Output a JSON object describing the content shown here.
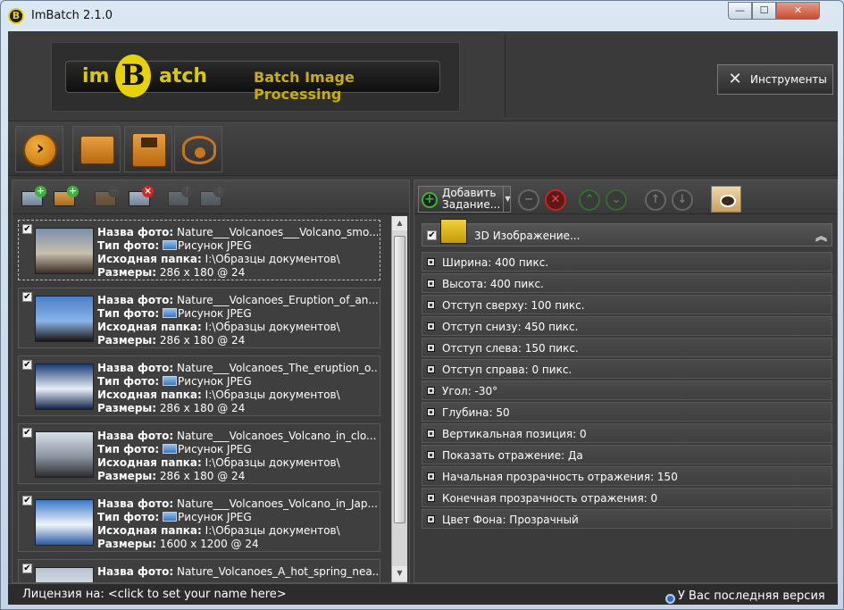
{
  "window": {
    "title": "ImBatch 2.1.0",
    "app_icon": "B",
    "min": "—",
    "max": "☐",
    "close": "✕"
  },
  "header": {
    "brand_im": "im",
    "brand_b": "B",
    "brand_atch": "atch",
    "tagline": "Batch Image Processing",
    "tools_label": "Инструменты",
    "tools_icon": "wrench-icon"
  },
  "main_toolbar": [
    {
      "name": "run-batch-button",
      "icon": "arrow-right-icon",
      "glyph": "›"
    },
    {
      "name": "open-folder-button",
      "icon": "folder-icon"
    },
    {
      "name": "save-button",
      "icon": "floppy-disk-icon"
    },
    {
      "name": "preview-button",
      "icon": "eye-icon"
    }
  ],
  "files": [
    {
      "name_label": "Назва фото:",
      "name": "Nature___Volcanoes___Volcano_smo...",
      "type_label": "Тип фото:",
      "type": "Рисунок JPEG",
      "folder_label": "Исходная папка:",
      "folder": "I:\\Образцы документов\\",
      "size_label": "Размеры:",
      "size": "286 x 180 @ 24",
      "checked": true,
      "thumb_colors": [
        "#7a8fa8",
        "#c8c0b0",
        "#3a2c22"
      ]
    },
    {
      "name_label": "Назва фото:",
      "name": "Nature___Volcanoes_Eruption_of_an...",
      "type_label": "Тип фото:",
      "type": "Рисунок JPEG",
      "folder_label": "Исходная папка:",
      "folder": "I:\\Образцы документов\\",
      "size_label": "Размеры:",
      "size": "286 x 180 @ 24",
      "checked": true,
      "thumb_colors": [
        "#4a7ec8",
        "#8ab4e8",
        "#1a1410"
      ]
    },
    {
      "name_label": "Назва фото:",
      "name": "Nature___Volcanoes_The_eruption_o...",
      "type_label": "Тип фото:",
      "type": "Рисунок JPEG",
      "folder_label": "Исходная папка:",
      "folder": "I:\\Образцы документов\\",
      "size_label": "Размеры:",
      "size": "286 x 180 @ 24",
      "checked": true,
      "thumb_colors": [
        "#1c3c78",
        "#e8eef6",
        "#142448"
      ]
    },
    {
      "name_label": "Назва фото:",
      "name": "Nature___Volcanoes_Volcano_in_clo...",
      "type_label": "Тип фото:",
      "type": "Рисунок JPEG",
      "folder_label": "Исходная папка:",
      "folder": "I:\\Образцы документов\\",
      "size_label": "Размеры:",
      "size": "286 x 180 @ 24",
      "checked": true,
      "thumb_colors": [
        "#d8e0e8",
        "#8a94a0",
        "#2c2c30"
      ]
    },
    {
      "name_label": "Назва фото:",
      "name": "Nature___Volcanoes_Volcano_in_Jap...",
      "type_label": "Тип фото:",
      "type": "Рисунок JPEG",
      "folder_label": "Исходная папка:",
      "folder": "I:\\Образцы документов\\",
      "size_label": "Размеры:",
      "size": "1600 x 1200 @ 24",
      "checked": true,
      "thumb_colors": [
        "#3a78c8",
        "#f0f4fa",
        "#2a5aa0"
      ]
    },
    {
      "name_label": "Назва фото:",
      "name": "Nature_Volcanoes_A_hot_spring_nea...",
      "checked": true,
      "thumb_colors": [
        "#b8c4d0",
        "#e0e4ea",
        "#8090a0"
      ]
    }
  ],
  "task": {
    "add_label": "Добавить Задание...",
    "title": "3D Изображение...",
    "collapse": "︽",
    "checked": true,
    "props": [
      "Ширина: 400 пикс.",
      "Высота: 400 пикс.",
      "Отступ сверху: 100 пикс.",
      "Отступ снизу: 450 пикс.",
      "Отступ слева: 150 пикс.",
      "Отступ справа: 0 пикс.",
      "Угол: -30°",
      "Глубина: 50",
      "Вертикальная позиция: 0",
      "Показать отражение: Да",
      "Начальная прозрачность отражения: 150",
      "Конечная прозрачность отражения: 0",
      "Цвет Фона: Прозрачный"
    ]
  },
  "status": {
    "license": "Лицензия на: <click to set your name here>",
    "version": "У Вас последняя версия"
  },
  "colors": {
    "panel": "#3b3b3b",
    "accent_yellow": "#d8cc00",
    "add_green": "#3bb33b",
    "delete_red": "#dd2222"
  }
}
